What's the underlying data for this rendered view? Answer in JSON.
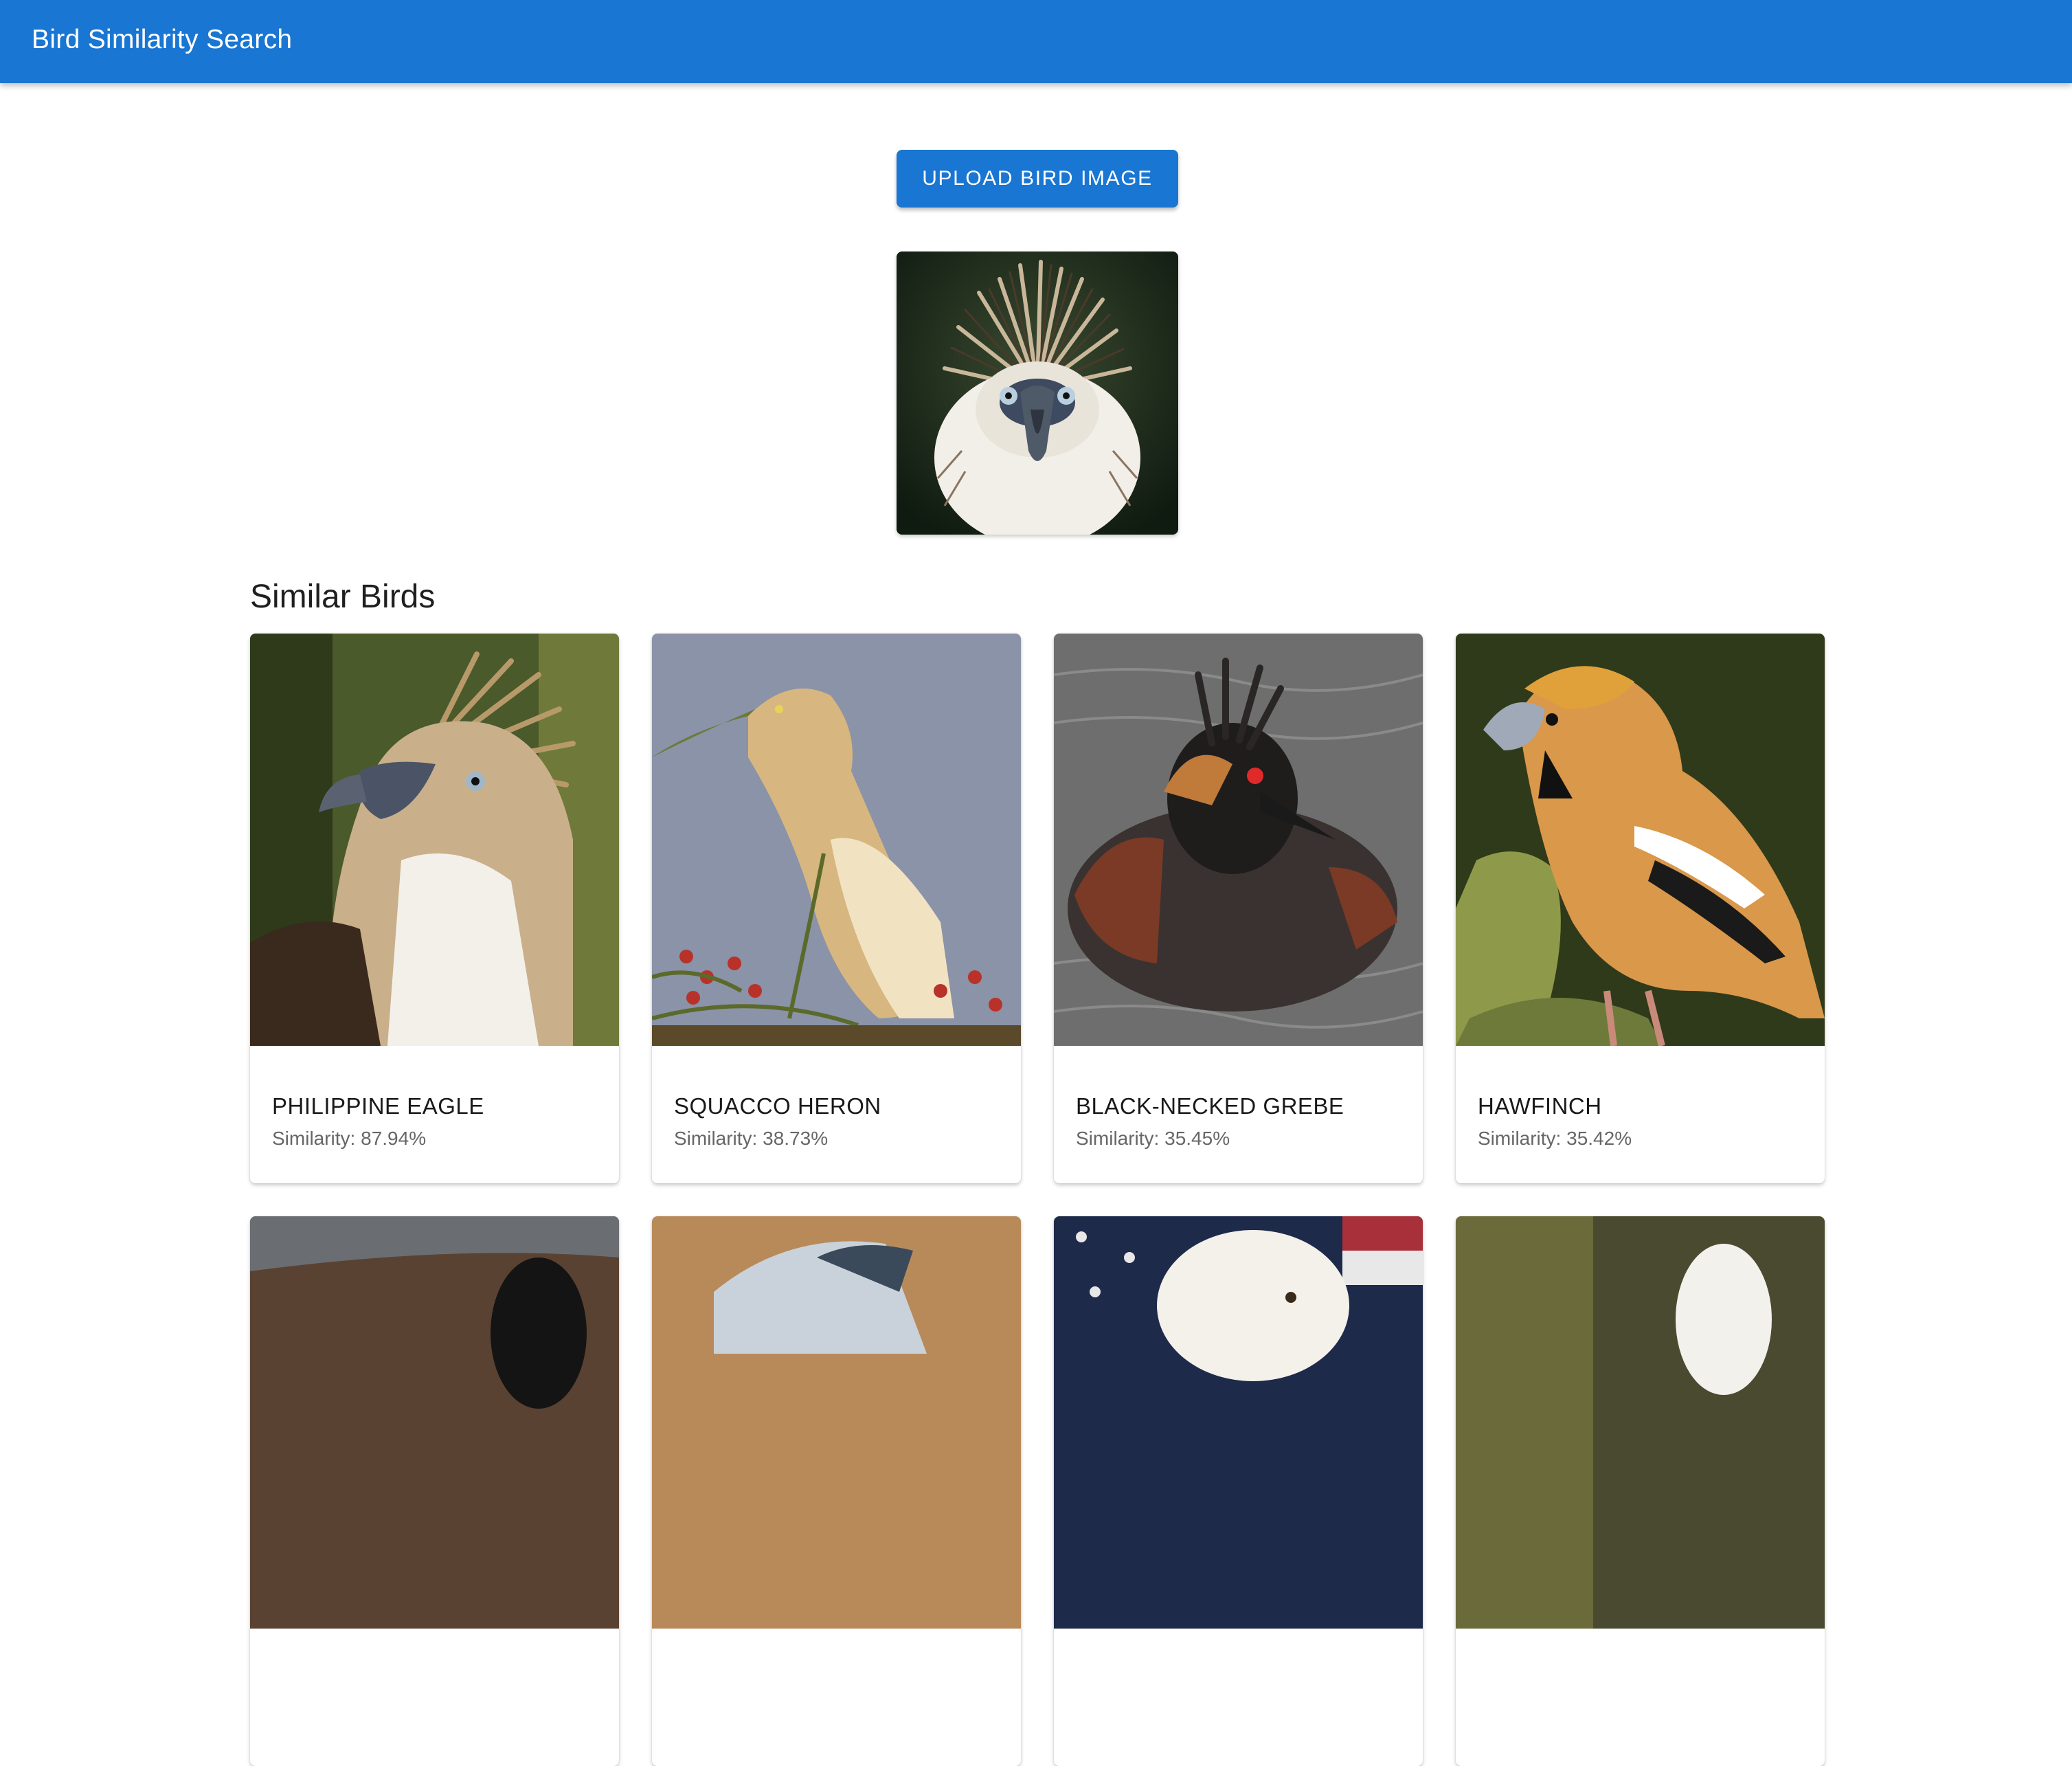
{
  "appbar": {
    "title": "Bird Similarity Search"
  },
  "upload": {
    "label": "UPLOAD BIRD IMAGE"
  },
  "query_image": {
    "subject": "Philippine eagle head, front view"
  },
  "results": {
    "title": "Similar Birds",
    "similarity_label": "Similarity:",
    "items": [
      {
        "name": "PHILIPPINE EAGLE",
        "similarity": "87.94%"
      },
      {
        "name": "SQUACCO HERON",
        "similarity": "38.73%"
      },
      {
        "name": "BLACK-NECKED GREBE",
        "similarity": "35.45%"
      },
      {
        "name": "HAWFINCH",
        "similarity": "35.42%"
      }
    ]
  },
  "colors": {
    "primary": "#1976d2",
    "appbar_text": "#ffffff",
    "secondary_text": "#666666"
  }
}
